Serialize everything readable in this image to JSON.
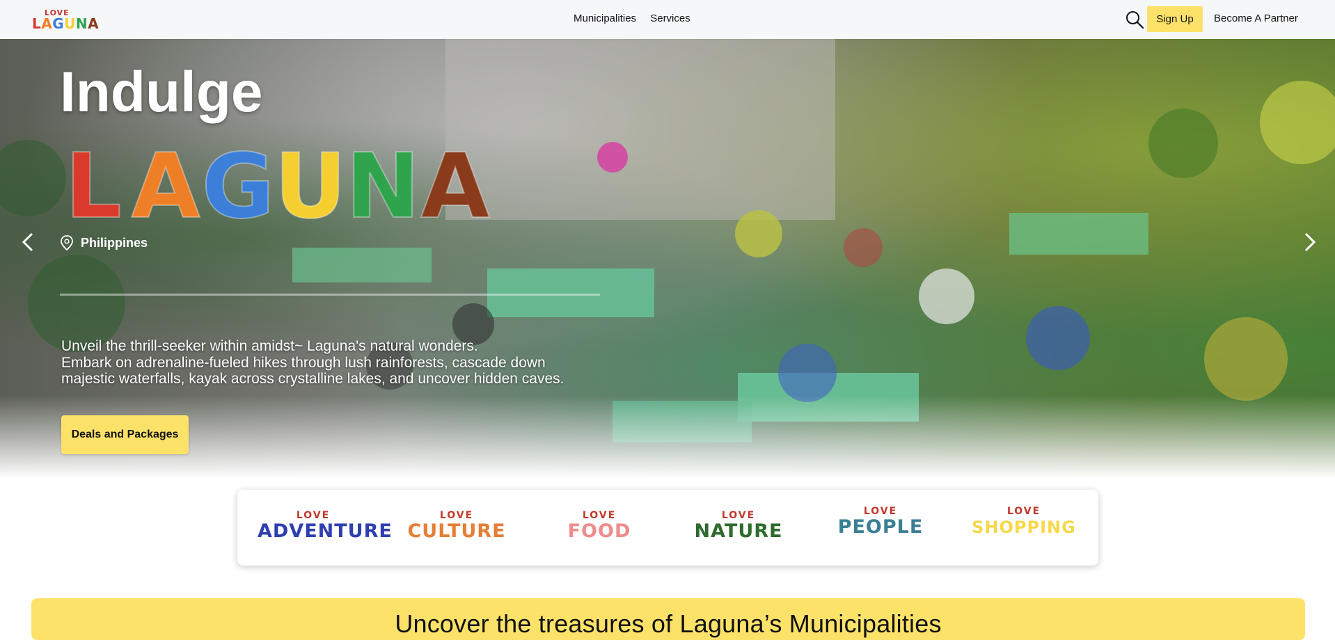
{
  "nav": {
    "logo_love": "LOVE",
    "logo_word": "LAGUNA",
    "links": [
      "Municipalities",
      "Services"
    ],
    "signup": "Sign Up",
    "partner": "Become A Partner"
  },
  "hero": {
    "headline": "Indulge",
    "destination": "LAGUNA",
    "location": "Philippines",
    "description_lines": [
      "Unveil the thrill-seeker within amidst~ Laguna's natural wonders.",
      "Embark on adrenaline-fueled hikes through lush rainforests, cascade down",
      "majestic waterfalls, kayak across crystalline lakes, and uncover hidden caves."
    ],
    "cta": "Deals and Packages"
  },
  "categories": [
    {
      "love": "LOVE",
      "name": "ADVENTURE",
      "color": "#2f3fb0"
    },
    {
      "love": "LOVE",
      "name": "CULTURE",
      "color": "#e67e35"
    },
    {
      "love": "LOVE",
      "name": "FOOD",
      "color": "#ef8c8c"
    },
    {
      "love": "LOVE",
      "name": "NATURE",
      "color": "#2e6b2e"
    },
    {
      "love": "LOVE",
      "name": "PEOPLE",
      "color": "#3a7f93"
    },
    {
      "love": "LOVE",
      "name": "SHOPPING",
      "color": "#f6d84a"
    }
  ],
  "section": {
    "title": "Uncover the treasures of Laguna’s Municipalities"
  },
  "colors": {
    "accent": "#fde26a",
    "laguna_letters": [
      "#d93a2c",
      "#ef7f27",
      "#3b7fd8",
      "#f5cf2f",
      "#2fa44d",
      "#8a3b1c"
    ]
  }
}
